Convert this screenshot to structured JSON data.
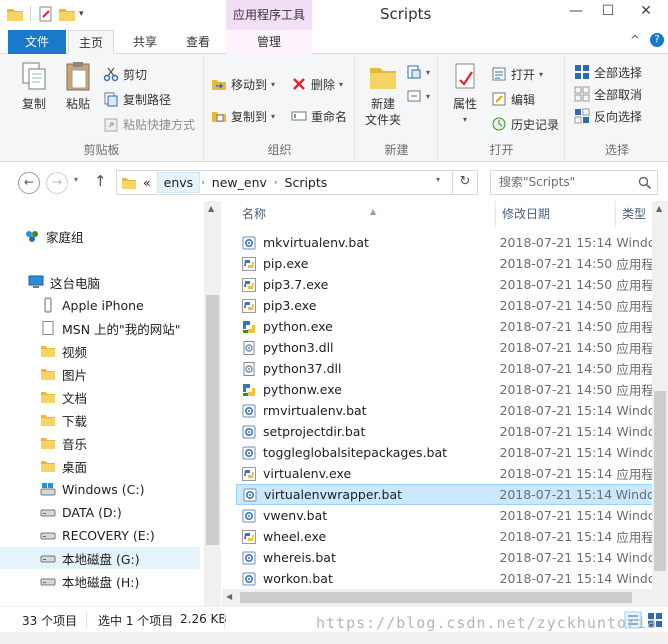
{
  "window": {
    "title": "Scripts",
    "context_tab_title": "应用程序工具",
    "minimize": "—",
    "maximize": "☐",
    "close": "✕"
  },
  "ribbon_tabs": [
    {
      "label": "文件"
    },
    {
      "label": "主页"
    },
    {
      "label": "共享"
    },
    {
      "label": "查看"
    },
    {
      "label": "管理"
    }
  ],
  "ribbon_collapse_glyph": "^",
  "ribbon_help_glyph": "?",
  "groups": {
    "clipboard": {
      "label": "剪贴板",
      "copy": "复制",
      "paste": "粘贴",
      "cut": "剪切",
      "copy_path": "复制路径",
      "paste_shortcut": "粘贴快捷方式"
    },
    "organize": {
      "label": "组织",
      "move_to": "移动到",
      "copy_to": "复制到",
      "delete": "删除",
      "rename": "重命名"
    },
    "new": {
      "label": "新建",
      "new_folder_line1": "新建",
      "new_folder_line2": "文件夹"
    },
    "open": {
      "label": "打开",
      "properties": "属性",
      "open": "打开",
      "edit": "编辑",
      "history": "历史记录"
    },
    "select": {
      "label": "选择",
      "select_all": "全部选择",
      "select_none": "全部取消",
      "invert": "反向选择"
    }
  },
  "address": {
    "back": "←",
    "forward": "→",
    "up": "↑",
    "overflow": "«",
    "crumbs": [
      "envs",
      "new_env",
      "Scripts"
    ],
    "refresh": "↻",
    "search_placeholder": "搜索\"Scripts\""
  },
  "nav_pane": [
    {
      "label": "家庭组",
      "icon": "homegroup-icon"
    },
    {
      "label": "这台电脑",
      "icon": "computer-icon"
    },
    {
      "label": "Apple iPhone",
      "icon": "phone-icon"
    },
    {
      "label": "MSN 上的\"我的网站\"",
      "icon": "page-icon"
    },
    {
      "label": "视频",
      "icon": "video-folder-icon"
    },
    {
      "label": "图片",
      "icon": "pictures-folder-icon"
    },
    {
      "label": "文档",
      "icon": "documents-folder-icon"
    },
    {
      "label": "下载",
      "icon": "downloads-folder-icon"
    },
    {
      "label": "音乐",
      "icon": "music-folder-icon"
    },
    {
      "label": "桌面",
      "icon": "desktop-folder-icon"
    },
    {
      "label": "Windows (C:)",
      "icon": "windows-drive-icon"
    },
    {
      "label": "DATA (D:)",
      "icon": "drive-icon"
    },
    {
      "label": "RECOVERY (E:)",
      "icon": "drive-icon"
    },
    {
      "label": "本地磁盘 (G:)",
      "icon": "drive-icon"
    },
    {
      "label": "本地磁盘 (H:)",
      "icon": "drive-icon"
    }
  ],
  "columns": {
    "name": "名称",
    "date": "修改日期",
    "type": "类型"
  },
  "files": [
    {
      "name": "mkvirtualenv.bat",
      "date": "2018-07-21 15:14",
      "type": "Windows",
      "icon": "bat-file-icon"
    },
    {
      "name": "pip.exe",
      "date": "2018-07-21 14:50",
      "type": "应用程序",
      "icon": "python-exe-icon"
    },
    {
      "name": "pip3.7.exe",
      "date": "2018-07-21 14:50",
      "type": "应用程序",
      "icon": "python-exe-icon"
    },
    {
      "name": "pip3.exe",
      "date": "2018-07-21 14:50",
      "type": "应用程序",
      "icon": "python-exe-icon"
    },
    {
      "name": "python.exe",
      "date": "2018-07-21 14:50",
      "type": "应用程序",
      "icon": "python-icon"
    },
    {
      "name": "python3.dll",
      "date": "2018-07-21 14:50",
      "type": "应用程序",
      "icon": "dll-file-icon"
    },
    {
      "name": "python37.dll",
      "date": "2018-07-21 14:50",
      "type": "应用程序",
      "icon": "dll-file-icon"
    },
    {
      "name": "pythonw.exe",
      "date": "2018-07-21 14:50",
      "type": "应用程序",
      "icon": "python-icon"
    },
    {
      "name": "rmvirtualenv.bat",
      "date": "2018-07-21 15:14",
      "type": "Windows",
      "icon": "bat-file-icon"
    },
    {
      "name": "setprojectdir.bat",
      "date": "2018-07-21 15:14",
      "type": "Windows",
      "icon": "bat-file-icon"
    },
    {
      "name": "toggleglobalsitepackages.bat",
      "date": "2018-07-21 15:14",
      "type": "Windows",
      "icon": "bat-file-icon"
    },
    {
      "name": "virtualenv.exe",
      "date": "2018-07-21 15:14",
      "type": "应用程序",
      "icon": "python-exe-icon"
    },
    {
      "name": "virtualenvwrapper.bat",
      "date": "2018-07-21 15:14",
      "type": "Windows",
      "icon": "bat-file-icon"
    },
    {
      "name": "vwenv.bat",
      "date": "2018-07-21 15:14",
      "type": "Windows",
      "icon": "bat-file-icon"
    },
    {
      "name": "wheel.exe",
      "date": "2018-07-21 15:14",
      "type": "应用程序",
      "icon": "python-exe-icon"
    },
    {
      "name": "whereis.bat",
      "date": "2018-07-21 15:14",
      "type": "Windows",
      "icon": "bat-file-icon"
    },
    {
      "name": "workon.bat",
      "date": "2018-07-21 15:14",
      "type": "Windows",
      "icon": "bat-file-icon"
    }
  ],
  "selected_file": "virtualenvwrapper.bat",
  "status": {
    "item_count": "33 个项目",
    "selection": "选中 1 个项目",
    "size": "2.26 KB"
  },
  "watermark": "https://blog.csdn.net/zyckhuntoria",
  "colors": {
    "file_tab": "#1979ca",
    "selection": "#cce8ff",
    "context_tab": "#f3dff5"
  }
}
